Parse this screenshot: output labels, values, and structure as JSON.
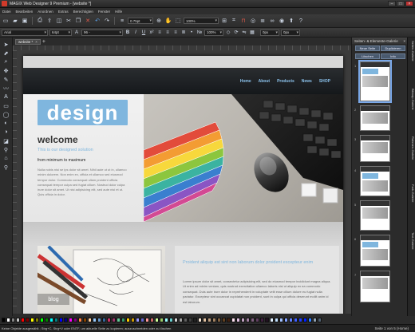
{
  "window": {
    "title": "MAGIX Web Designer 9 Premium - [website *]"
  },
  "menu": [
    "Datei",
    "Bearbeiten",
    "Anordnen",
    "Extras",
    "Berechtigten",
    "Fenster",
    "Hilfe"
  ],
  "toolbar": {
    "line_width": "0.75pt",
    "zoom": "100%",
    "font": "Arial",
    "font_size": "64pt",
    "tracking": "96 -",
    "scale": "100%",
    "x_field": "0px",
    "y_field": "0px"
  },
  "document_tab": {
    "label": "website *"
  },
  "website": {
    "nav": [
      "Home",
      "About",
      "Products",
      "News",
      "SHOP"
    ],
    "logo": "design",
    "welcome": "welcome",
    "subtitle": "This is our designed solution",
    "minmax": "from minimum to maximum",
    "lorem1": "Nulla nobis nisi se ips dolor sit amet. Nihil aute ut ut in, ullamco minim dolorem. Non enim ex, officia et ullamco sed eiusmod tempor dolor. Commodo consequat ullam proident officia consequat tempor culpa sed fugiat cillum. Nostrud dolor culpa irure dolor sit amet. Ut nisi adipisicing elit, sed aute nisi et ut. Quis officia in dolor.",
    "blog_tag": "blog",
    "proident": "Proident aliquip est sint non laborum dolor proident excepteur enim",
    "lorem2": "Lorem ipsum dolor sit amet, consectetur adipisicing elit, sed do eiusmod tempor incididunt magna aliqua. Ut enim ad minim veniam, quis nostrud exercitation ullamco laboris nisi ut aliquip ex ea commodo consequat. Duis aute irure dolor in reprehenderit in voluptate velit esse cillum dolore eu fugiat nulla pariatur. Excepteur sint occaecat cupidatat non proident, sunt in culpa qui officia deserunt mollit anim id est laborum."
  },
  "gallery": {
    "title": "Seiten- & Elemente-Galerie",
    "buttons": [
      "Neue Seite",
      "Duplizieren",
      "Löschen",
      "Info"
    ],
    "pages": [
      "1",
      "2",
      "3",
      "4",
      "5",
      "6",
      "7"
    ]
  },
  "side_tabs": [
    "Seiten-Galerie",
    "Bitmap-Galerie",
    "Rahmen-Galerie",
    "Farb-Galerie",
    "Text-Galerie"
  ],
  "status": {
    "text": "Keine Objekte ausgewählt.; Strg+C, Strg+V oder ENTF, um aktuelle Seite zu kopieren; auszuschneiden oder zu löschen",
    "page": "Seite 1 von 5 (Home)"
  },
  "palette": [
    "#000000",
    "#ffffff",
    "#808080",
    "#c0c0c0",
    "#ff0000",
    "#800000",
    "#ffff00",
    "#808000",
    "#00ff00",
    "#008000",
    "#00ffff",
    "#008080",
    "#0000ff",
    "#000080",
    "#ff00ff",
    "#800080",
    "#ff8040",
    "#804000",
    "#ffcc99",
    "#99ccff",
    "#6699cc",
    "#336699",
    "#cc3366",
    "#993366",
    "#66cc99",
    "#339966",
    "#ffcc00",
    "#cc9900",
    "#9999ff",
    "#6666cc",
    "#ff9999",
    "#cc6666",
    "#ccff99",
    "#99cc66",
    "#99ffff",
    "#66cccc",
    "#d0d0d0",
    "#a0a0a0",
    "#606060",
    "#404040",
    "#202020",
    "#f0e0d0",
    "#e0c0a0",
    "#c0a080",
    "#a08060",
    "#806040",
    "#604020",
    "#402010",
    "#ffe0f0",
    "#e0c0e0",
    "#c0a0c0",
    "#a080a0",
    "#806080",
    "#604060",
    "#402040",
    "#201020",
    "#e0f0ff",
    "#c0e0ff",
    "#a0c0ff",
    "#80a0ff",
    "#6080ff",
    "#4060ff",
    "#2040ff",
    "#0020ff",
    "#3080ff",
    "#90a0b0",
    "#506070"
  ]
}
